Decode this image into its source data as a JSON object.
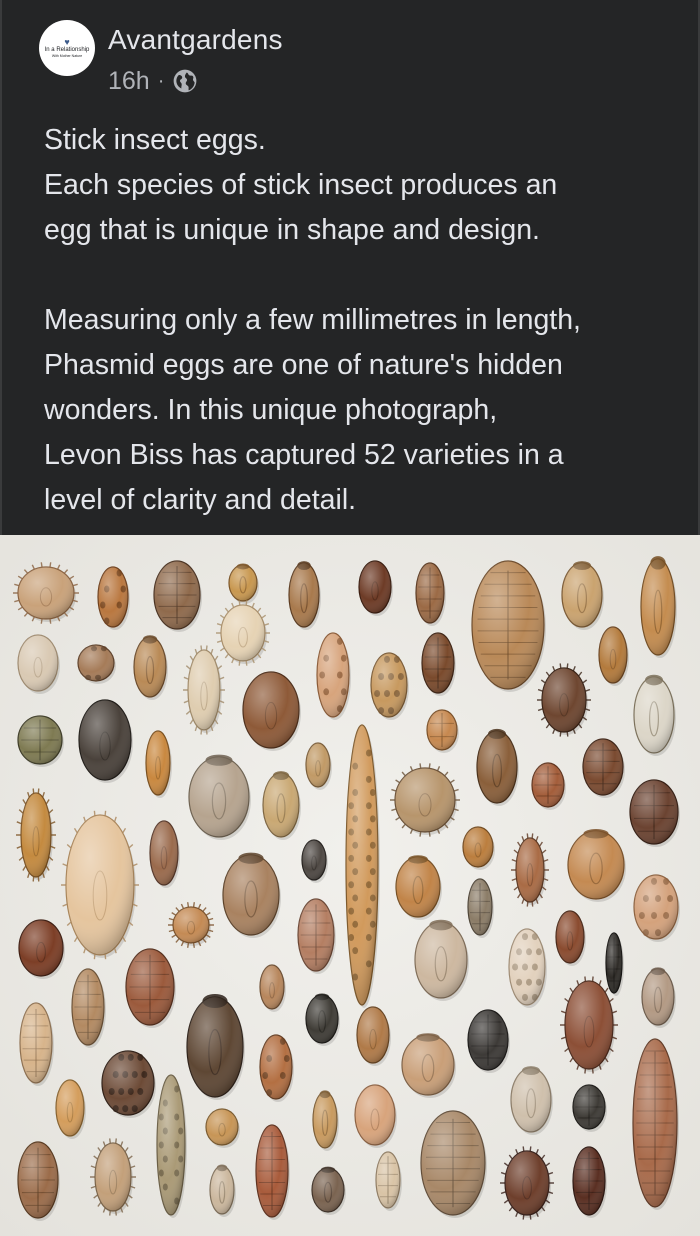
{
  "post": {
    "author": "Avantgardens",
    "time": "16h",
    "separator": "·",
    "visibility_icon": "globe-icon",
    "avatar": {
      "line1": "In a Relationship",
      "line2": "With Mother Nature"
    },
    "caption": {
      "line1": "Stick insect eggs.",
      "line2": "Each species of stick insect produces an",
      "line3": "egg that is unique in shape and design.",
      "line4": "Measuring only a few millimetres in length,",
      "line5": "Phasmid eggs are one of nature's hidden",
      "line6": "wonders.  In this unique photograph,",
      "line7": "Levon Biss has captured 52 varieties in a",
      "line8": "level of clarity and detail."
    }
  },
  "colors": {
    "post_background": "#242526",
    "primary_text": "#e4e6eb",
    "secondary_text": "#b0b3b8",
    "photo_background": "#ecebe6"
  }
}
